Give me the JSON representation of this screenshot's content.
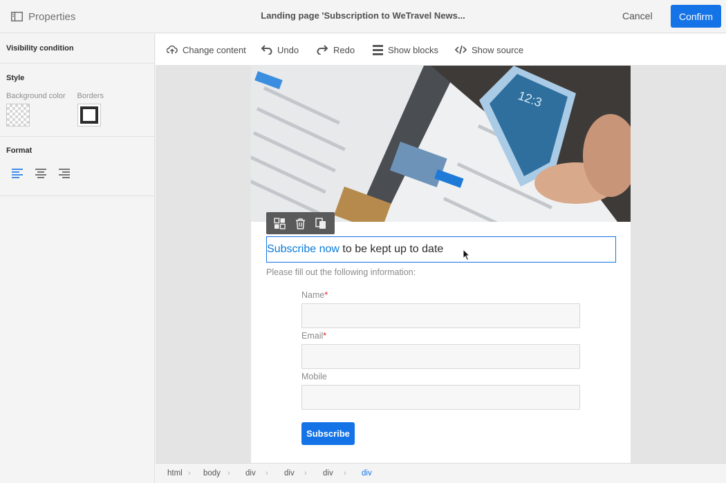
{
  "header": {
    "panel_title": "Properties",
    "page_title": "Landing page 'Subscription to WeTravel News...",
    "cancel_label": "Cancel",
    "confirm_label": "Confirm"
  },
  "left_panel": {
    "visibility_title": "Visibility condition",
    "style_title": "Style",
    "background_label": "Background color",
    "borders_label": "Borders",
    "format_title": "Format",
    "selected_alignment": "left"
  },
  "toolbar": {
    "change_content": "Change content",
    "undo": "Undo",
    "redo": "Redo",
    "show_blocks": "Show blocks",
    "show_source": "Show source"
  },
  "content": {
    "headline_link": "Subscribe now",
    "headline_rest": " to be kept up to date",
    "intro": "Please fill out the following information:",
    "fields": [
      {
        "label": "Name",
        "required": "*"
      },
      {
        "label": "Email",
        "required": "*"
      },
      {
        "label": "Mobile",
        "required": ""
      }
    ],
    "submit_label": "Subscribe"
  },
  "breadcrumb": [
    "html",
    "body",
    "div",
    "div",
    "div",
    "div"
  ],
  "colors": {
    "accent": "#1473e6",
    "link": "#0a7bd8",
    "required": "#e02020"
  }
}
